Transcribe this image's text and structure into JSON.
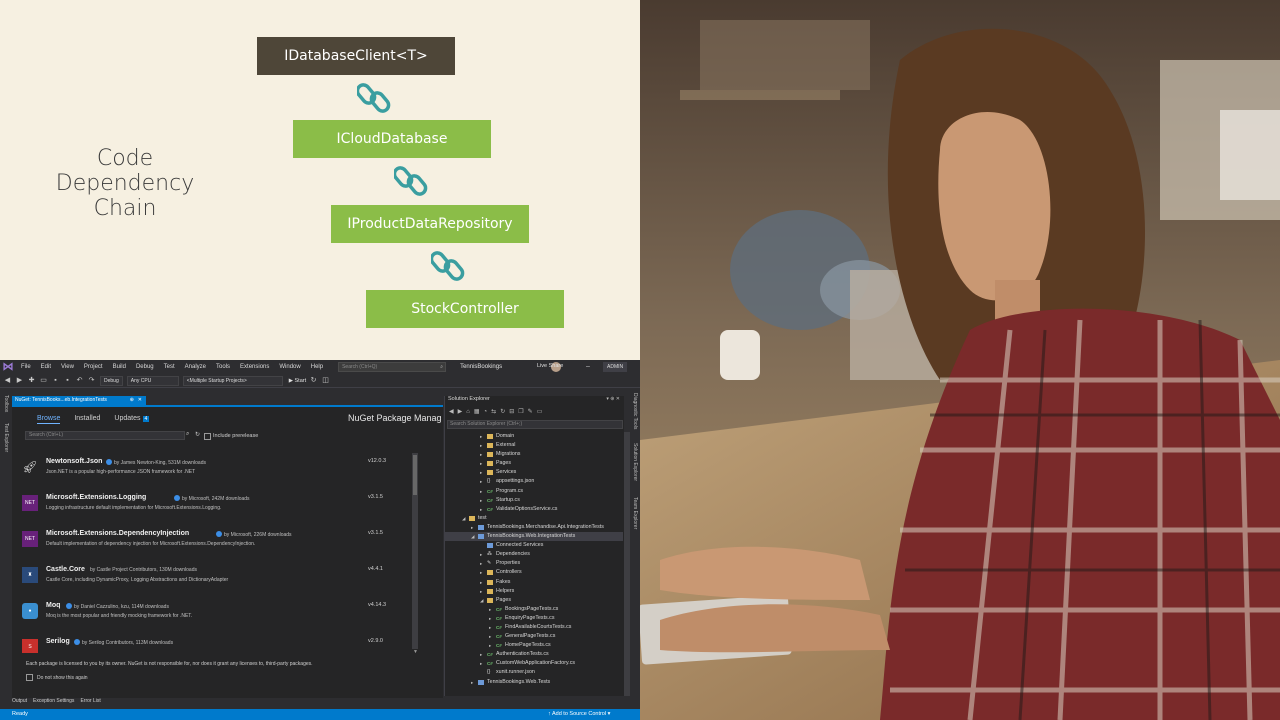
{
  "slide": {
    "title_lines": [
      "Code",
      "Dependency",
      "Chain"
    ],
    "chain": [
      "IDatabaseClient<T>",
      "ICloudDatabase",
      "IProductDataRepository",
      "StockController"
    ],
    "colors": {
      "dark_box": "#4e4638",
      "green_box": "#8bbd48",
      "link": "#3a9ea0",
      "background": "#f6f0e1"
    }
  },
  "vs": {
    "menu": [
      "File",
      "Edit",
      "View",
      "Project",
      "Build",
      "Debug",
      "Test",
      "Analyze",
      "Tools",
      "Extensions",
      "Window",
      "Help"
    ],
    "search_placeholder": "Search (Ctrl+Q)",
    "solution_name": "TennisBookings",
    "toolbar": {
      "config": "Debug",
      "platform": "Any CPU",
      "startup": "<Multiple Startup Projects>",
      "start": "▶ Start",
      "live_share": "Live Share",
      "admin": "ADMIN"
    },
    "left_strip": [
      "Toolbox",
      "Test Explorer"
    ],
    "right_strip": [
      "Diagnostic Tools",
      "Solution Explorer",
      "Team Explorer"
    ],
    "nuget": {
      "tab_label": "NuGet: TennisBooks...eb.IntegrationTests",
      "tabs": {
        "browse": "Browse",
        "installed": "Installed",
        "updates": "Updates",
        "updates_count": "4"
      },
      "heading": "NuGet Package Manag",
      "search_placeholder": "Search (Ctrl+L)",
      "include_prerelease": "Include prerelease",
      "packages": [
        {
          "name": "Newtonsoft.Json",
          "by": "by James Newton-King, 531M downloads",
          "desc": "Json.NET is a popular high-performance JSON framework for .NET",
          "version": "v12.0.3",
          "icon": "rocket-icon",
          "color": "#1e1e1e"
        },
        {
          "name": "Microsoft.Extensions.Logging",
          "by": "by Microsoft, 242M downloads",
          "desc": "Logging infrastructure default implementation for Microsoft.Extensions.Logging.",
          "version": "v3.1.5",
          "icon": "NET",
          "color": "#68217a"
        },
        {
          "name": "Microsoft.Extensions.DependencyInjection",
          "by": "by Microsoft, 226M downloads",
          "desc": "Default implementation of dependency injection for Microsoft.Extensions.DependencyInjection.",
          "version": "v3.1.5",
          "icon": "NET",
          "color": "#68217a"
        },
        {
          "name": "Castle.Core",
          "by": "by Castle Project Contributors, 130M downloads",
          "desc": "Castle Core, including DynamicProxy, Logging Abstractions and DictionaryAdapter",
          "version": "v4.4.1",
          "icon": "castle-icon",
          "color": "#2a4a7a"
        },
        {
          "name": "Moq",
          "by": "by Daniel Cazzulino, kzu, 114M downloads",
          "desc": "Moq is the most popular and friendly mocking framework for .NET.",
          "version": "v4.14.3",
          "icon": "moq-icon",
          "color": "#3a8fd0"
        },
        {
          "name": "Serilog",
          "by": "by Serilog Contributors, 113M downloads",
          "desc": "",
          "version": "v2.9.0",
          "icon": "serilog-icon",
          "color": "#c8302c"
        }
      ],
      "license_note": "Each package is licensed to you by its owner. NuGet is not responsible for, nor does it grant any licenses to, third-party packages.",
      "dont_show": "Do not show this again"
    },
    "bottom_tabs": [
      "Output",
      "Exception Settings",
      "Error List"
    ],
    "status": {
      "ready": "Ready",
      "source_control": "↑ Add to Source Control ▾"
    },
    "solution_explorer": {
      "title": "Solution Explorer",
      "search_placeholder": "Search Solution Explorer (Ctrl+;)",
      "tree": [
        {
          "label": "Domain",
          "type": "folder",
          "level": 3,
          "expander": "▸"
        },
        {
          "label": "External",
          "type": "folder",
          "level": 3,
          "expander": "▸"
        },
        {
          "label": "Migrations",
          "type": "folder",
          "level": 3,
          "expander": "▸"
        },
        {
          "label": "Pages",
          "type": "folder",
          "level": 3,
          "expander": "▸"
        },
        {
          "label": "Services",
          "type": "folder",
          "level": 3,
          "expander": "▸"
        },
        {
          "label": "appsettings.json",
          "type": "json",
          "level": 3,
          "expander": "▸"
        },
        {
          "label": "Program.cs",
          "type": "cs",
          "level": 3,
          "expander": "▸"
        },
        {
          "label": "Startup.cs",
          "type": "cs",
          "level": 3,
          "expander": "▸"
        },
        {
          "label": "ValidateOptionsService.cs",
          "type": "cs",
          "level": 3,
          "expander": "▸"
        },
        {
          "label": "test",
          "type": "folder",
          "level": 1,
          "expander": "◢"
        },
        {
          "label": "TennisBookings.Merchandise.Api.IntegrationTests",
          "type": "proj",
          "level": 2,
          "expander": "▸"
        },
        {
          "label": "TennisBookings.Web.IntegrationTests",
          "type": "proj",
          "level": 2,
          "expander": "◢",
          "selected": true
        },
        {
          "label": "Connected Services",
          "type": "svc",
          "level": 3,
          "expander": ""
        },
        {
          "label": "Dependencies",
          "type": "deps",
          "level": 3,
          "expander": "▸"
        },
        {
          "label": "Properties",
          "type": "props",
          "level": 3,
          "expander": "▸"
        },
        {
          "label": "Controllers",
          "type": "folder",
          "level": 3,
          "expander": "▸"
        },
        {
          "label": "Fakes",
          "type": "folder",
          "level": 3,
          "expander": "▸"
        },
        {
          "label": "Helpers",
          "type": "folder",
          "level": 3,
          "expander": "▸"
        },
        {
          "label": "Pages",
          "type": "folder",
          "level": 3,
          "expander": "◢"
        },
        {
          "label": "BookingsPageTests.cs",
          "type": "cs",
          "level": 4,
          "expander": "▸"
        },
        {
          "label": "EnquiryPageTests.cs",
          "type": "cs",
          "level": 4,
          "expander": "▸"
        },
        {
          "label": "FindAvailableCourtsTests.cs",
          "type": "cs",
          "level": 4,
          "expander": "▸"
        },
        {
          "label": "GeneralPageTests.cs",
          "type": "cs",
          "level": 4,
          "expander": "▸"
        },
        {
          "label": "HomePageTests.cs",
          "type": "cs",
          "level": 4,
          "expander": "▸"
        },
        {
          "label": "AuthenticationTests.cs",
          "type": "cs",
          "level": 3,
          "expander": "▸"
        },
        {
          "label": "CustomWebApplicationFactory.cs",
          "type": "cs",
          "level": 3,
          "expander": "▸"
        },
        {
          "label": "xunit.runner.json",
          "type": "json",
          "level": 3,
          "expander": ""
        },
        {
          "label": "TennisBookings.Web.Tests",
          "type": "proj",
          "level": 2,
          "expander": "▸"
        }
      ]
    }
  },
  "photo": {
    "colors": {
      "shirt": "#7a2a2a",
      "hair": "#5a3a22",
      "skin": "#c99873",
      "table": "#a07a52"
    }
  }
}
